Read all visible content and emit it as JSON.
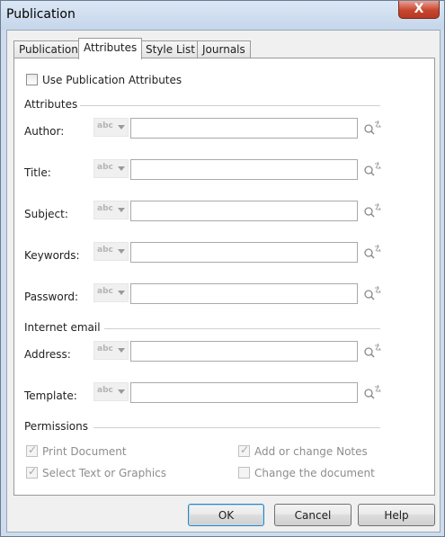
{
  "window": {
    "title": "Publication",
    "close_label": "X"
  },
  "tabs": [
    "Publication",
    "Attributes",
    "Style List",
    "Journals"
  ],
  "active_tab": "Attributes",
  "use_publication_attributes": {
    "label": "Use Publication Attributes",
    "checked": false
  },
  "groups": {
    "attributes": "Attributes",
    "internet_email": "Internet email",
    "permissions": "Permissions"
  },
  "fields": [
    {
      "label": "Author:",
      "value": ""
    },
    {
      "label": "Title:",
      "value": ""
    },
    {
      "label": "Subject:",
      "value": ""
    },
    {
      "label": "Keywords:",
      "value": ""
    },
    {
      "label": "Password:",
      "value": ""
    },
    {
      "label": "Address:",
      "value": ""
    },
    {
      "label": "Template:",
      "value": ""
    }
  ],
  "abc_label": "abc",
  "permissions": [
    {
      "label": "Print Document",
      "checked": true
    },
    {
      "label": "Add or change Notes",
      "checked": true
    },
    {
      "label": "Select Text or Graphics",
      "checked": true
    },
    {
      "label": "Change the document",
      "checked": false
    }
  ],
  "buttons": {
    "ok": "OK",
    "cancel": "Cancel",
    "help": "Help"
  },
  "icons": {
    "field_action": "find-replace-icon",
    "close": "close-icon",
    "dropdown": "chevron-down-icon"
  }
}
